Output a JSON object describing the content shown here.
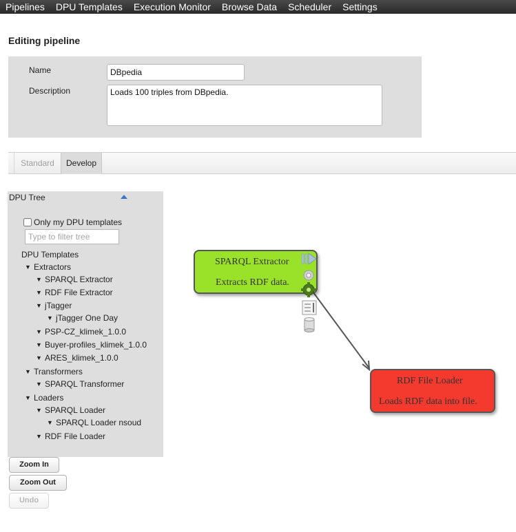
{
  "nav": {
    "items": [
      {
        "label": "Pipelines"
      },
      {
        "label": "DPU Templates"
      },
      {
        "label": "Execution Monitor"
      },
      {
        "label": "Browse Data"
      },
      {
        "label": "Scheduler"
      },
      {
        "label": "Settings"
      }
    ]
  },
  "page": {
    "title": "Editing pipeline"
  },
  "form": {
    "name_label": "Name",
    "name_value": "DBpedia",
    "description_label": "Description",
    "description_value": "Loads 100 triples from DBpedia."
  },
  "tabs": {
    "standard": "Standard",
    "develop": "Develop",
    "active": "develop"
  },
  "dpu_tree": {
    "title": "DPU Tree",
    "only_my_label": "Only my DPU templates",
    "only_my_checked": false,
    "filter_placeholder": "Type to filter tree",
    "root_label": "DPU Templates",
    "extractors": "Extractors",
    "sparql_extractor": "SPARQL Extractor",
    "rdf_file_extractor": "RDF File Extractor",
    "jtagger": "jTagger",
    "jtagger_one_day": "jTagger One Day",
    "psp_cz": "PSP-CZ_klimek_1.0.0",
    "buyer_profiles": "Buyer-profiles_klimek_1.0.0",
    "ares": "ARES_klimek_1.0.0",
    "transformers": "Transformers",
    "sparql_transformer": "SPARQL Transformer",
    "loaders": "Loaders",
    "sparql_loader": "SPARQL Loader",
    "sparql_loader_nsoud": "SPARQL Loader nsoud",
    "rdf_file_loader": "RDF File Loader"
  },
  "buttons": {
    "zoom_in": "Zoom In",
    "zoom_out": "Zoom Out",
    "undo": "Undo"
  },
  "canvas": {
    "extractor_node": {
      "name": "SPARQL Extractor",
      "description": "Extracts RDF data.",
      "color": "#9ae22a"
    },
    "loader_node": {
      "name": "RDF File Loader",
      "description": "Loads RDF data into file.",
      "color": "#f43a2e"
    }
  },
  "colors": {
    "nav_bg": "#333333",
    "panel_bg": "#dedede"
  }
}
